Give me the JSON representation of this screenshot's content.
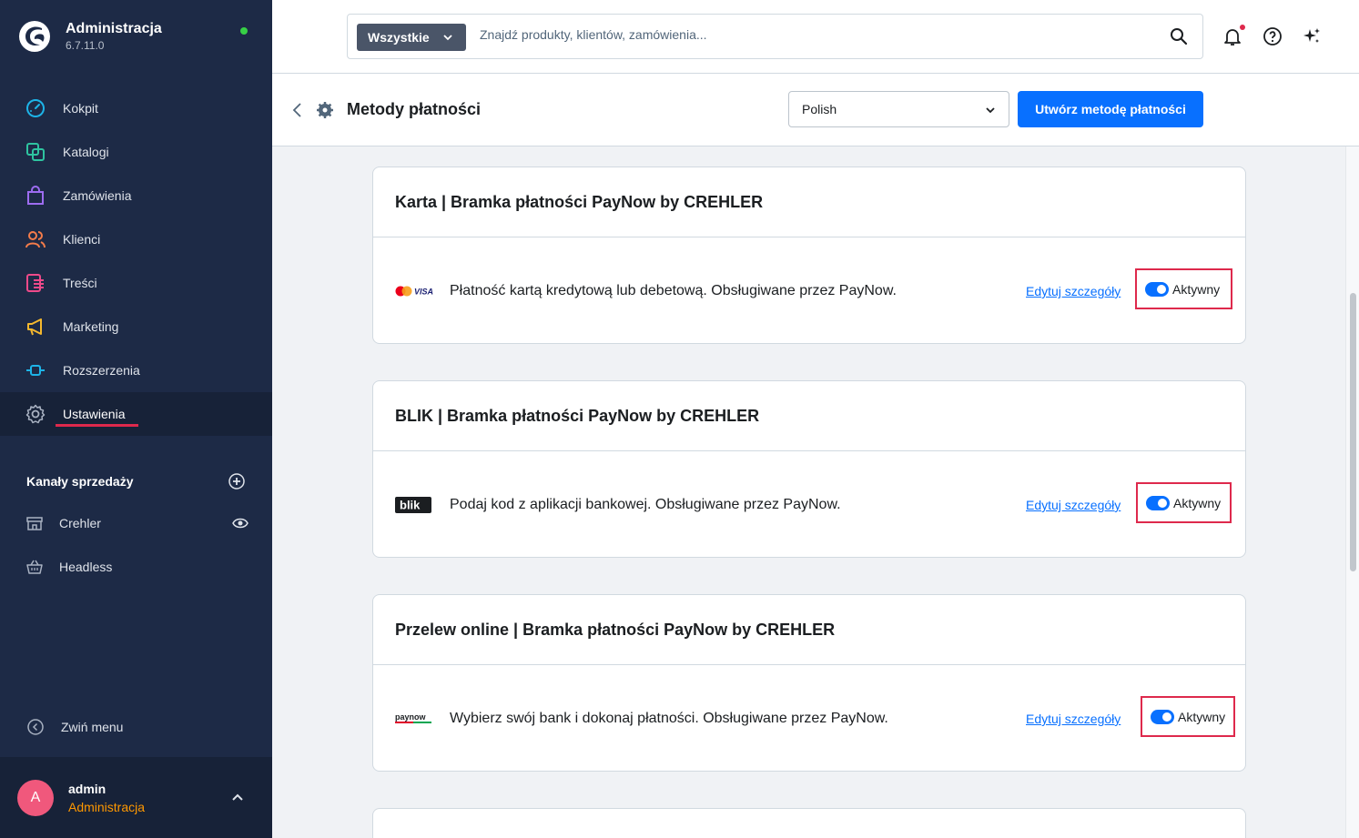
{
  "app": {
    "title": "Administracja",
    "version": "6.7.11.0"
  },
  "sidebar": {
    "items": [
      {
        "label": "Kokpit",
        "icon": "dashboard-icon"
      },
      {
        "label": "Katalogi",
        "icon": "catalog-icon"
      },
      {
        "label": "Zamówienia",
        "icon": "shopping-bag-icon"
      },
      {
        "label": "Klienci",
        "icon": "users-icon"
      },
      {
        "label": "Treści",
        "icon": "content-icon"
      },
      {
        "label": "Marketing",
        "icon": "megaphone-icon"
      },
      {
        "label": "Rozszerzenia",
        "icon": "plug-icon"
      },
      {
        "label": "Ustawienia",
        "icon": "gear-icon",
        "active": true
      }
    ],
    "sales_channels": {
      "title": "Kanały sprzedaży",
      "items": [
        {
          "label": "Crehler",
          "icon": "storefront-icon"
        },
        {
          "label": "Headless",
          "icon": "basket-icon"
        }
      ]
    },
    "collapse_label": "Zwiń menu",
    "user": {
      "initial": "A",
      "name": "admin",
      "role": "Administracja"
    }
  },
  "search": {
    "type_label": "Wszystkie",
    "placeholder": "Znajdź produkty, klientów, zamówienia..."
  },
  "page": {
    "title": "Metody płatności",
    "language": "Polish",
    "create_label": "Utwórz metodę płatności"
  },
  "payment_methods": [
    {
      "title": "Karta | Bramka płatności PayNow by CREHLER",
      "logo": "mastercard-visa-logo",
      "description": "Płatność kartą kredytową lub debetową. Obsługiwane przez PayNow.",
      "edit_label": "Edytuj szczegóły",
      "status_label": "Aktywny"
    },
    {
      "title": "BLIK | Bramka płatności PayNow by CREHLER",
      "logo": "blik-logo",
      "description": "Podaj kod z aplikacji bankowej. Obsługiwane przez PayNow.",
      "edit_label": "Edytuj szczegóły",
      "status_label": "Aktywny"
    },
    {
      "title": "Przelew online | Bramka płatności PayNow by CREHLER",
      "logo": "paynow-logo",
      "description": "Wybierz swój bank i dokonaj płatności. Obsługiwane przez PayNow.",
      "edit_label": "Edytuj szczegóły",
      "status_label": "Aktywny"
    }
  ],
  "colors": {
    "sidebar_bg": "#1d2a46",
    "primary": "#0870ff",
    "highlight": "#de294c",
    "role": "#ff9800"
  }
}
